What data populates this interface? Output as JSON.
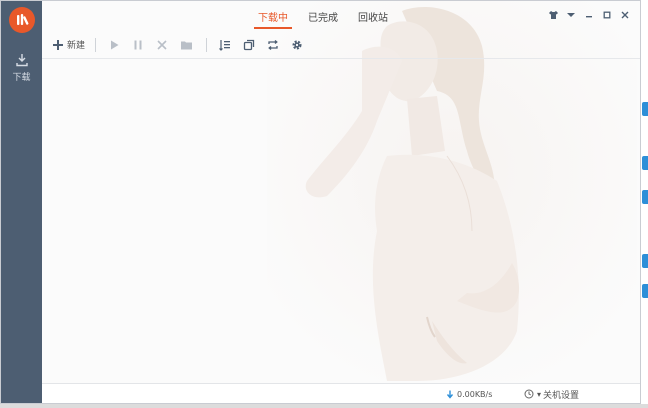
{
  "tabs": [
    {
      "label": "下载中",
      "active": true
    },
    {
      "label": "已完成",
      "active": false
    },
    {
      "label": "回收站",
      "active": false
    }
  ],
  "sidebar": {
    "items": [
      {
        "label": "下载",
        "icon": "download-icon"
      }
    ]
  },
  "toolbar": {
    "new_label": "新建",
    "buttons": [
      "add-icon",
      "play-icon",
      "pause-icon",
      "delete-icon",
      "folder-icon",
      "list-icon",
      "copy-icon",
      "repeat-icon",
      "gear-icon"
    ]
  },
  "window_controls": [
    "shirt-icon",
    "dropdown-icon",
    "minimize-icon",
    "maximize-icon",
    "close-icon"
  ],
  "status": {
    "speed": "0.00KB/s",
    "shutdown_arrow": "▾",
    "shutdown_label": "关机设置"
  },
  "colors": {
    "accent": "#e8582a",
    "sidebar_bg": "#4d5e72",
    "icon": "#4d5e72"
  }
}
